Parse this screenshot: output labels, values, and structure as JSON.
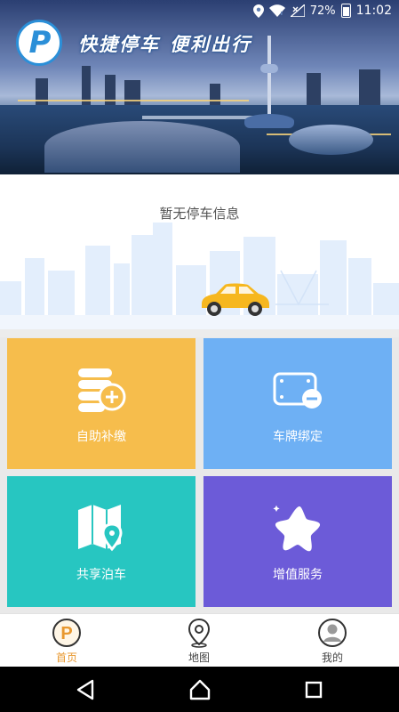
{
  "status_bar": {
    "battery": "72%",
    "time": "11:02",
    "icons": [
      "location-icon",
      "wifi-icon",
      "no-signal-icon",
      "battery-icon"
    ]
  },
  "banner": {
    "slogan_left": "快捷停车",
    "slogan_right": "便利出行",
    "logo_letter": "P"
  },
  "parking": {
    "empty_message": "暂无停车信息"
  },
  "tiles": [
    {
      "label": "自助补缴",
      "icon": "coins-add-icon",
      "color": "#f6bd4c"
    },
    {
      "label": "车牌绑定",
      "icon": "license-plate-icon",
      "color": "#6eb0f4"
    },
    {
      "label": "共享泊车",
      "icon": "map-pin-icon",
      "color": "#27c6c1"
    },
    {
      "label": "增值服务",
      "icon": "star-icon",
      "color": "#6c5bd8"
    }
  ],
  "bottom_nav": [
    {
      "label": "首页",
      "icon": "parking-p-icon",
      "active": true
    },
    {
      "label": "地图",
      "icon": "map-marker-icon",
      "active": false
    },
    {
      "label": "我的",
      "icon": "user-avatar-icon",
      "active": false
    }
  ],
  "colors": {
    "accent": "#e8982f",
    "brand_blue": "#2b8fd8"
  }
}
